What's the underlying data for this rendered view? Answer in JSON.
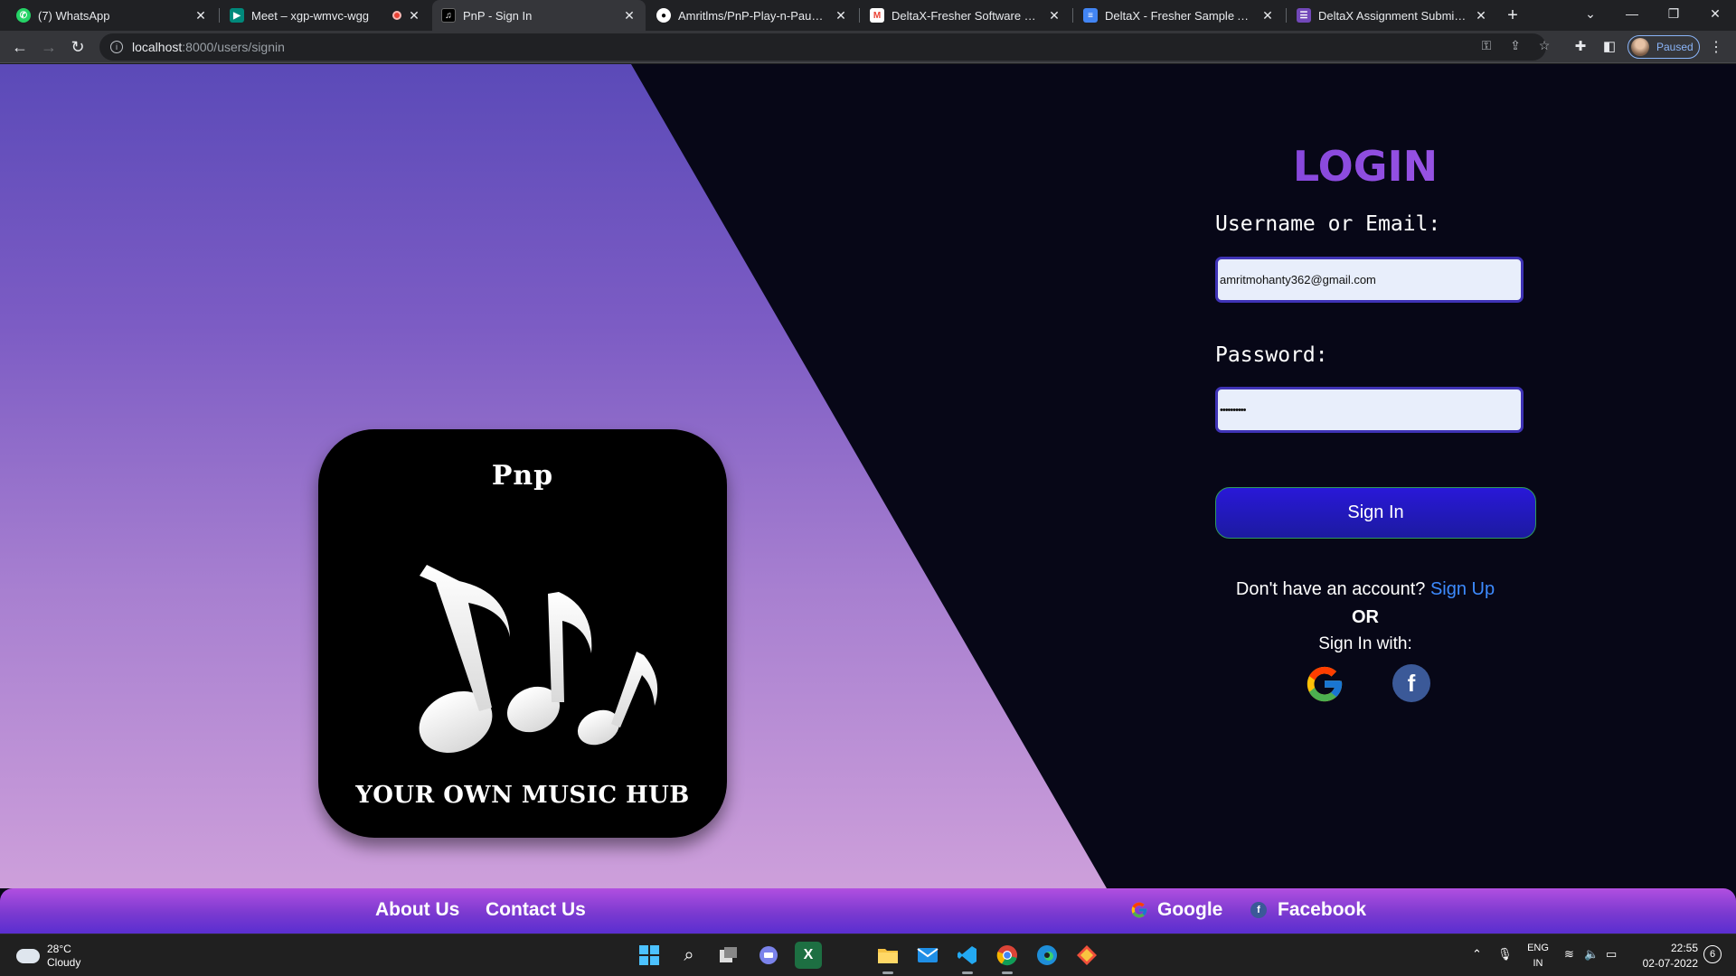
{
  "browser": {
    "tabs": [
      {
        "title": "(7) WhatsApp",
        "favicon": "whatsapp-icon",
        "color": "#25d366"
      },
      {
        "title": "Meet – xgp-wmvc-wgg",
        "favicon": "meet-icon",
        "color": "#00897b"
      },
      {
        "title": "PnP - Sign In",
        "favicon": "pnp-icon",
        "color": "#000000"
      },
      {
        "title": "Amritlms/PnP-Play-n-Pause-: It d",
        "favicon": "github-icon",
        "color": "#ffffff"
      },
      {
        "title": "DeltaX-Fresher Software Engine",
        "favicon": "gmail-icon",
        "color": "#ea4335"
      },
      {
        "title": "DeltaX - Fresher Sample App - S",
        "favicon": "docs-icon",
        "color": "#4285f4"
      },
      {
        "title": "DeltaX Assignment Submission",
        "favicon": "forms-icon",
        "color": "#7248b9"
      }
    ],
    "url_host": "localhost",
    "url_path": ":8000/users/signin",
    "profile_status": "Paused"
  },
  "page": {
    "logo": {
      "title": "Pnp",
      "tagline": "YOUR OWN MUSIC HUB"
    },
    "login": {
      "title": "LOGIN",
      "username_label": "Username or Email:",
      "username_value": "amritmohanty362@gmail.com",
      "password_label": "Password:",
      "password_value": "••••••••••",
      "submit_label": "Sign In",
      "signup_prompt": "Don't have an account?",
      "signup_link": "Sign Up",
      "or_text": "OR",
      "sign_in_with": "Sign In with:"
    },
    "footer": {
      "about": "About Us",
      "contact": "Contact Us",
      "google": "Google",
      "facebook": "Facebook"
    }
  },
  "taskbar": {
    "weather_temp": "28°C",
    "weather_desc": "Cloudy",
    "lang_top": "ENG",
    "lang_bottom": "IN",
    "time": "22:55",
    "date": "02-07-2022",
    "notifications": "6"
  },
  "colors": {
    "accent_purple": "#7a3fd6",
    "button_blue": "#2918d8",
    "link_blue": "#3d8bff",
    "page_dark": "#070717"
  }
}
